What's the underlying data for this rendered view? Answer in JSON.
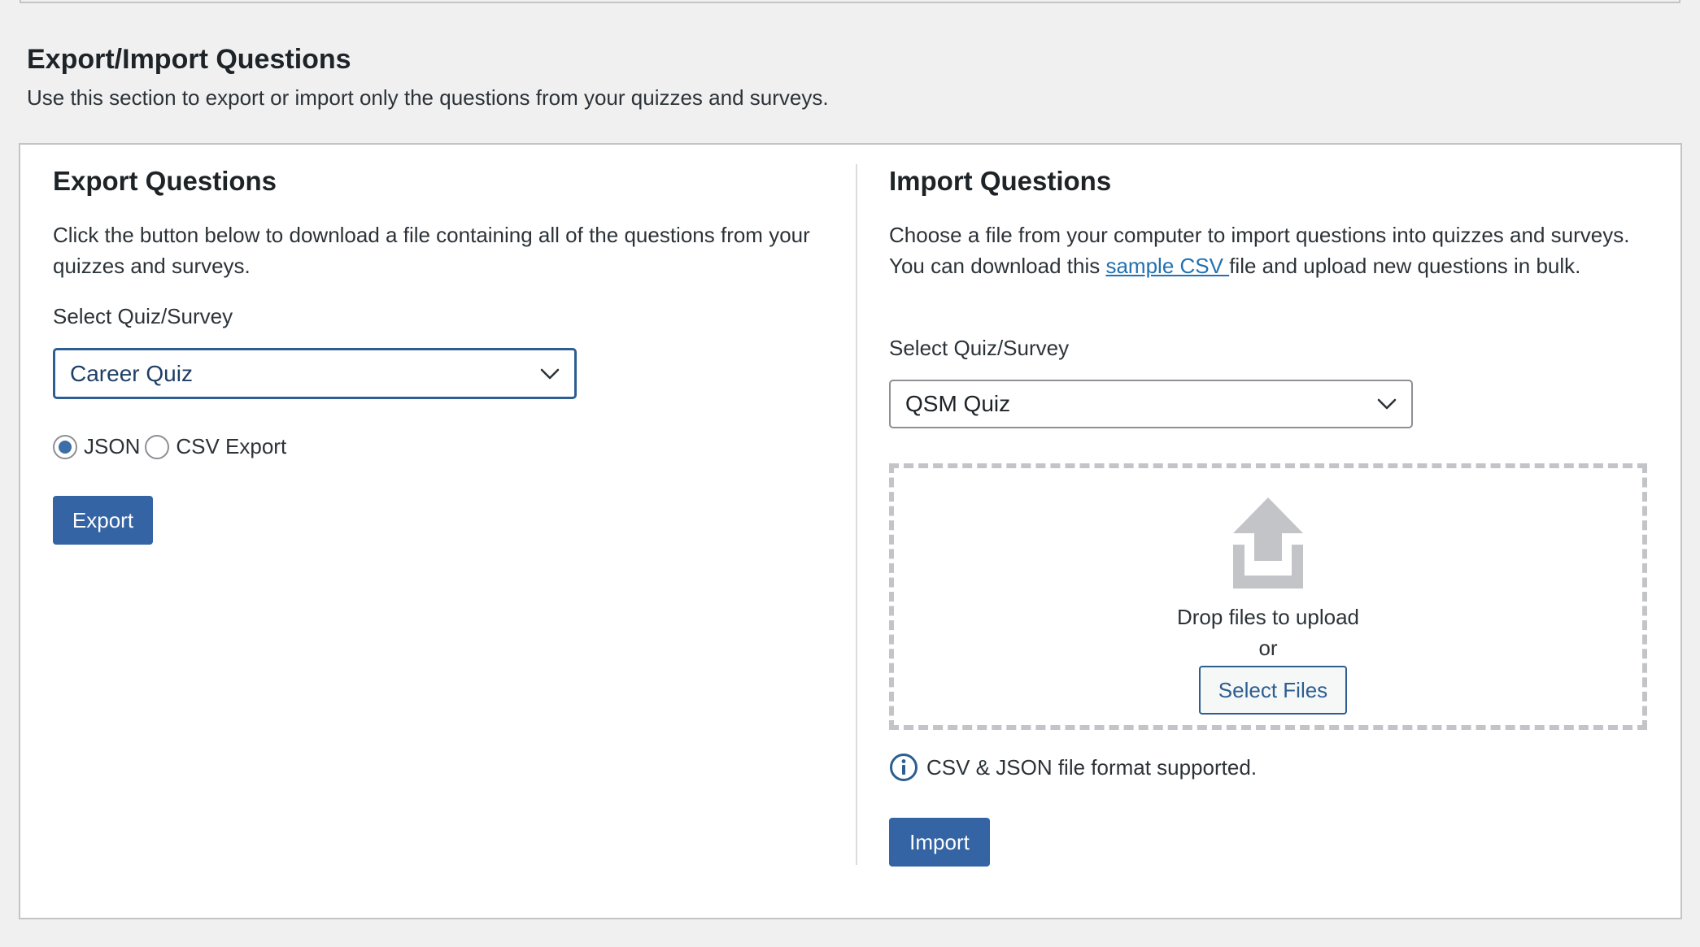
{
  "section": {
    "title": "Export/Import Questions",
    "description": "Use this section to export or import only the questions from your quizzes and surveys."
  },
  "export": {
    "title": "Export Questions",
    "intro": "Click the button below to download a file containing all of the questions from your quizzes and surveys.",
    "select_label": "Select Quiz/Survey",
    "selected_quiz": "Career Quiz",
    "format_options": [
      {
        "label": "JSON",
        "checked": true
      },
      {
        "label": "CSV Export",
        "checked": false
      }
    ],
    "button_label": "Export"
  },
  "import": {
    "title": "Import Questions",
    "intro_before_link": "Choose a file from your computer to import questions into quizzes and surveys. You can download this ",
    "link_text": "sample CSV ",
    "intro_after_link": "file and upload new questions in bulk.",
    "select_label": "Select Quiz/Survey",
    "selected_quiz": "QSM Quiz",
    "dropzone": {
      "icon": "upload-icon",
      "drop_text": "Drop files to upload",
      "or_text": "or",
      "select_button": "Select Files"
    },
    "format_note": "CSV & JSON file format supported.",
    "button_label": "Import"
  },
  "colors": {
    "primary": "#3464a4",
    "link": "#2271b1",
    "background": "#f0f0f1",
    "card": "#ffffff",
    "border": "#c3c4c7"
  }
}
